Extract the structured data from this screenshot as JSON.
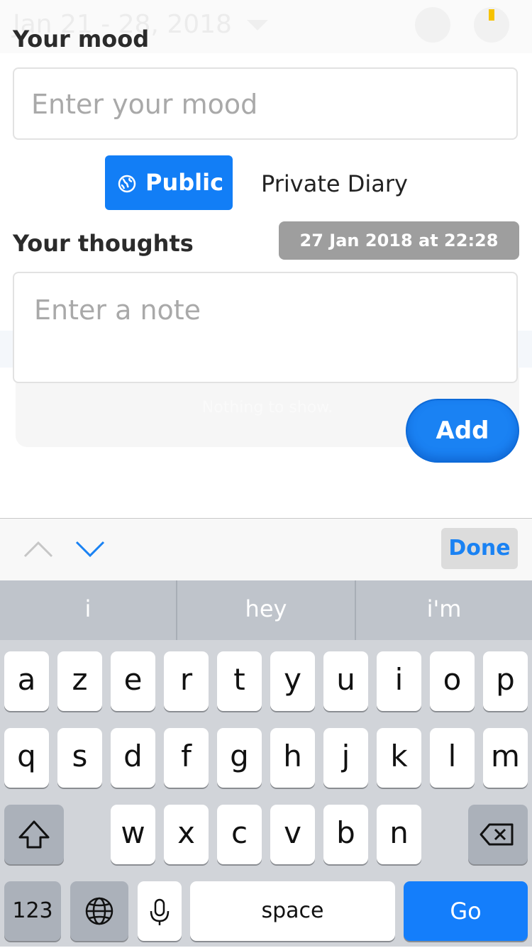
{
  "background": {
    "date_range": "Jan 21 - 28, 2018",
    "empty_state": "Nothing to show."
  },
  "mood": {
    "label": "Your mood",
    "placeholder": "Enter your mood"
  },
  "visibility": {
    "public_label": "Public",
    "private_label": "Private Diary",
    "selected": "Public"
  },
  "thoughts": {
    "label": "Your thoughts",
    "timestamp": "27 Jan 2018 at 22:28",
    "placeholder": "Enter a note"
  },
  "add_label": "Add",
  "accessory": {
    "done_label": "Done"
  },
  "predictions": [
    "i",
    "hey",
    "i'm"
  ],
  "keyboard": {
    "row1": [
      "a",
      "z",
      "e",
      "r",
      "t",
      "y",
      "u",
      "i",
      "o",
      "p"
    ],
    "row2": [
      "q",
      "s",
      "d",
      "f",
      "g",
      "h",
      "j",
      "k",
      "l",
      "m"
    ],
    "row3": [
      "w",
      "x",
      "c",
      "v",
      "b",
      "n"
    ],
    "numbers_label": "123",
    "space_label": "space",
    "go_label": "Go"
  },
  "colors": {
    "accent": "#127ef6",
    "timestamp_bg": "#9e9e9e",
    "keyboard_bg": "#d1d4d9",
    "notification_dot": "#f6c200"
  }
}
